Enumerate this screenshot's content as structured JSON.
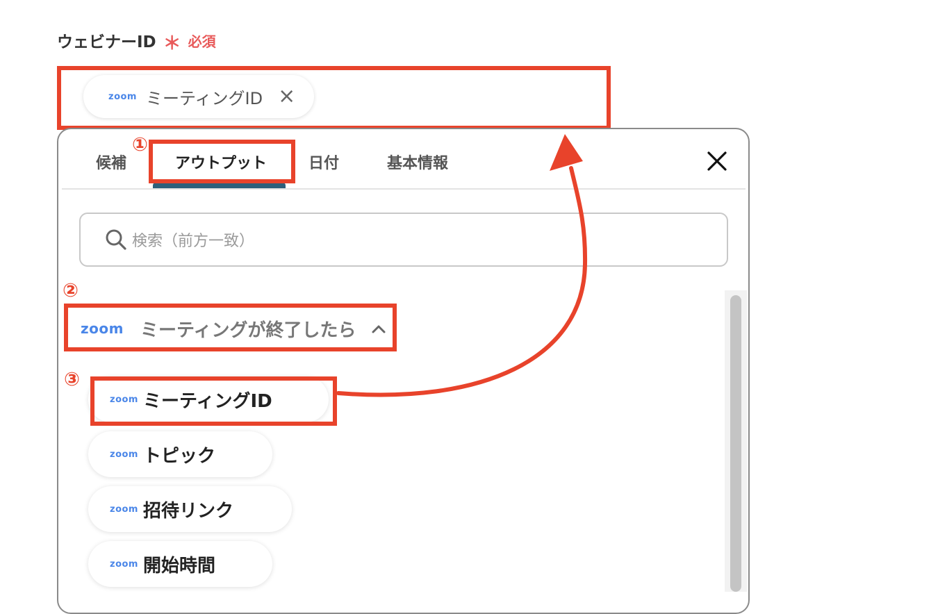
{
  "field": {
    "label": "ウェビナーID",
    "required_mark": "＊",
    "required_text": "必須"
  },
  "token": {
    "logo": "zoom",
    "text": "ミーティングID",
    "remove": "×"
  },
  "tabs": [
    {
      "label": "候補"
    },
    {
      "label": "アウトプット"
    },
    {
      "label": "日付"
    },
    {
      "label": "基本情報"
    }
  ],
  "search": {
    "placeholder": "検索（前方一致）"
  },
  "group": {
    "logo": "zoom",
    "title": "ミーティングが終了したら"
  },
  "items": [
    {
      "logo": "zoom",
      "label": "ミーティングID"
    },
    {
      "logo": "zoom",
      "label": "トピック"
    },
    {
      "logo": "zoom",
      "label": "招待リンク"
    },
    {
      "logo": "zoom",
      "label": "開始時間"
    }
  ],
  "annotations": {
    "step1": "①",
    "step2": "②",
    "step3": "③"
  },
  "colors": {
    "annotation": "#e8432b",
    "tab_active": "#2c5f7a",
    "zoom_brand": "#4a86e8",
    "required": "#e85a5a"
  }
}
